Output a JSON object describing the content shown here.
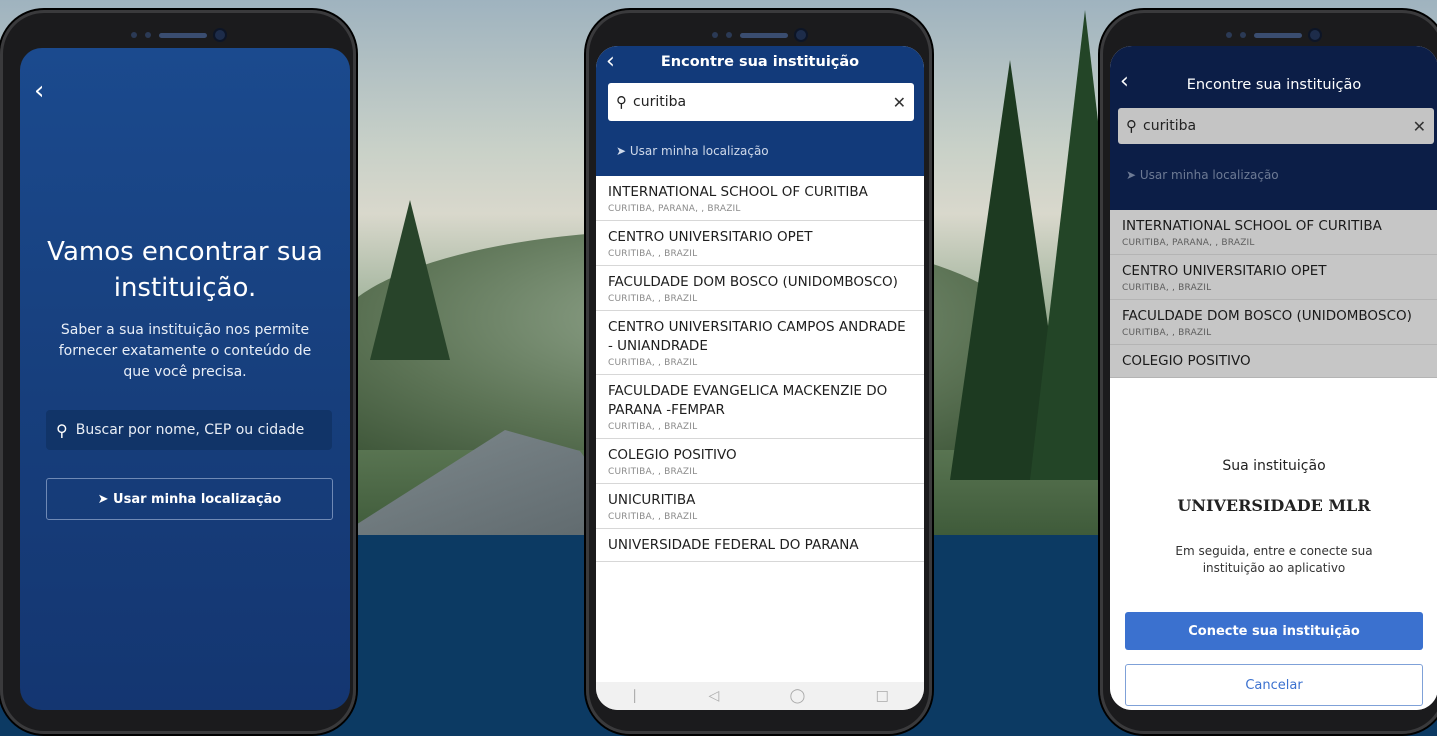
{
  "phone1": {
    "back": "‹",
    "heading_line1": "Vamos encontrar sua",
    "heading_line2": "instituição.",
    "subtitle": "Saber a sua instituição nos permite fornecer exatamente o conteúdo de que você precisa.",
    "search_icon": "search-icon",
    "search_placeholder": "Buscar por nome, CEP ou cidade",
    "location_button": "➤ Usar minha localização"
  },
  "phone2": {
    "back": "‹",
    "title": "Encontre sua instituição",
    "search_value": "curitiba",
    "clear": "✕",
    "location": "➤ Usar minha localização",
    "results": [
      {
        "name": "INTERNATIONAL SCHOOL OF CURITIBA",
        "city": "CURITIBA, PARANA, , BRAZIL"
      },
      {
        "name": "CENTRO UNIVERSITARIO OPET",
        "city": "CURITIBA, , BRAZIL"
      },
      {
        "name": "FACULDADE DOM BOSCO (UNIDOMBOSCO)",
        "city": "CURITIBA, , BRAZIL"
      },
      {
        "name": "CENTRO UNIVERSITARIO CAMPOS ANDRADE - UNIANDRADE",
        "city": "CURITIBA, , BRAZIL"
      },
      {
        "name": "FACULDADE EVANGELICA MACKENZIE DO PARANA -FEMPAR",
        "city": "CURITIBA, , BRAZIL"
      },
      {
        "name": "COLEGIO POSITIVO",
        "city": "CURITIBA, , BRAZIL"
      },
      {
        "name": "UNICURITIBA",
        "city": "CURITIBA, , BRAZIL"
      },
      {
        "name": "UNIVERSIDADE FEDERAL DO PARANA",
        "city": ""
      }
    ]
  },
  "phone3": {
    "back": "‹",
    "title": "Encontre sua instituição",
    "search_value": "curitiba",
    "clear": "✕",
    "location": "➤ Usar minha localização",
    "results": [
      {
        "name": "INTERNATIONAL SCHOOL OF CURITIBA",
        "city": "CURITIBA, PARANA, , BRAZIL"
      },
      {
        "name": "CENTRO UNIVERSITARIO OPET",
        "city": "CURITIBA, , BRAZIL"
      },
      {
        "name": "FACULDADE DOM BOSCO (UNIDOMBOSCO)",
        "city": "CURITIBA, , BRAZIL"
      },
      {
        "name": "COLEGIO POSITIVO",
        "city": ""
      }
    ],
    "sheet_title": "Sua instituição",
    "institution": "UNIVERSIDADE MLR",
    "sheet_text": "Em seguida, entre e conecte sua instituição ao aplicativo",
    "connect_button": "Conecte sua instituição",
    "cancel_button": "Cancelar"
  },
  "colors": {
    "navy": "#0c3a63",
    "header": "#123a7a",
    "accent": "#3b71cf"
  }
}
